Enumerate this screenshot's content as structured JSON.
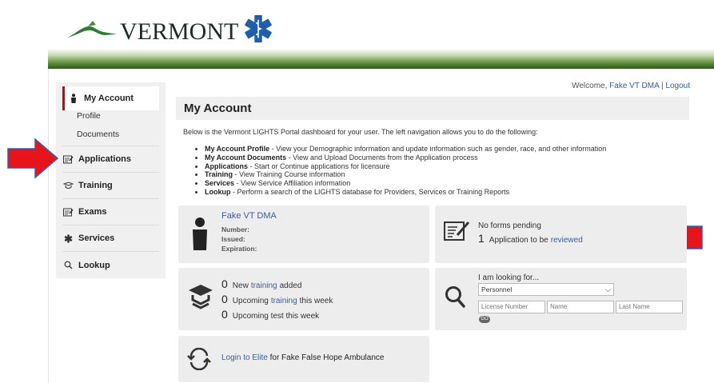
{
  "header": {
    "logo_text": "VERMONT"
  },
  "sidebar": {
    "my_account": "My Account",
    "profile": "Profile",
    "documents": "Documents",
    "applications": "Applications",
    "training": "Training",
    "exams": "Exams",
    "services": "Services",
    "lookup": "Lookup"
  },
  "welcome": {
    "prefix": "Welcome,",
    "user": "Fake VT DMA",
    "sep": "|",
    "logout": "Logout"
  },
  "page": {
    "title": "My Account",
    "intro": "Below is the Vermont LIGHTS Portal dashboard for your user. The left navigation allows you to do the following:",
    "bullets": [
      {
        "label": "My Account Profile",
        "text": " - View your Demographic information and update information such as gender, race, and other information"
      },
      {
        "label": "My Account Documents",
        "text": " - View and Upload Documents from the Application process"
      },
      {
        "label": "Applications",
        "text": " - Start or Continue applications for licensure"
      },
      {
        "label": "Training",
        "text": " - View Training Course information"
      },
      {
        "label": "Services",
        "text": " - View Service Affiliation information"
      },
      {
        "label": "Lookup",
        "text": " - Perform a search of the LIGHTS database for Providers, Services or Training Reports"
      }
    ]
  },
  "profile_card": {
    "name": "Fake VT DMA",
    "number_label": "Number:",
    "issued_label": "Issued:",
    "expiration_label": "Expiration:"
  },
  "forms_card": {
    "pending": "No forms pending",
    "count": "1",
    "text": "Application to be",
    "link": "reviewed"
  },
  "training_card": {
    "row1_count": "0",
    "row1_pre": "New",
    "row1_link": "training",
    "row1_post": "added",
    "row2_count": "0",
    "row2_pre": "Upcoming",
    "row2_link": "training",
    "row2_post": "this week",
    "row3_count": "0",
    "row3_text": "Upcoming test this week"
  },
  "search_card": {
    "label": "I am looking for...",
    "select_value": "Personnel",
    "license_placeholder": "License Number",
    "name_placeholder": "Name",
    "last_name_placeholder": "Last Name",
    "go": "GO"
  },
  "elite_card": {
    "link": "Login to Elite",
    "text": "for Fake False Hope Ambulance"
  },
  "colors": {
    "accent_link": "#3a5c9a",
    "arrow_red": "#e8141b",
    "arrow_outline": "#3b5aa8",
    "header_green": "#2c5a18"
  }
}
